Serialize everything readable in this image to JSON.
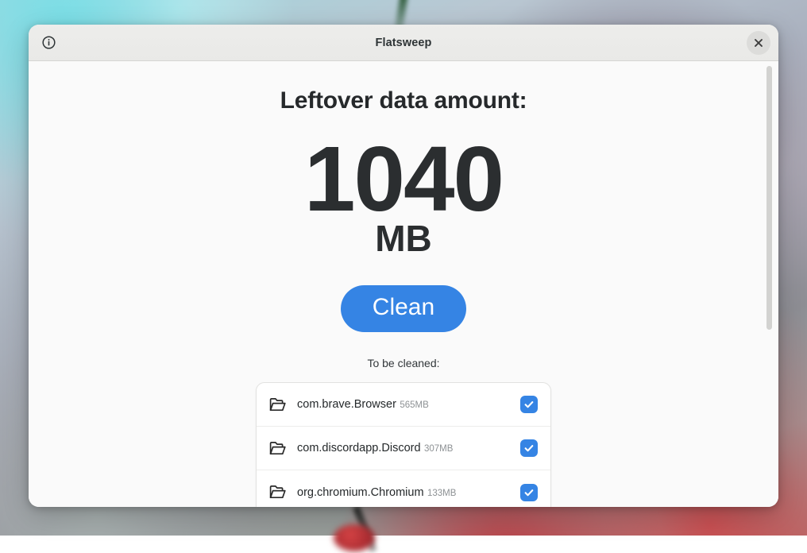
{
  "window": {
    "title": "Flatsweep",
    "about_icon": "info-circle-icon",
    "close_icon": "close-icon"
  },
  "main": {
    "heading": "Leftover data amount:",
    "amount_value": "1040",
    "amount_unit": "MB",
    "clean_button_label": "Clean",
    "to_be_cleaned_label": "To be cleaned:"
  },
  "colors": {
    "accent": "#3584e4",
    "headerbar": "#eaeae8",
    "content_bg": "#fafafa",
    "card_bg": "#ffffff",
    "text": "#24282a",
    "subtext": "#8d9194"
  },
  "clean_list": [
    {
      "name": "com.brave.Browser",
      "size": "565MB",
      "icon": "folder-open-icon",
      "checked": true
    },
    {
      "name": "com.discordapp.Discord",
      "size": "307MB",
      "icon": "folder-open-icon",
      "checked": true
    },
    {
      "name": "org.chromium.Chromium",
      "size": "133MB",
      "icon": "folder-open-icon",
      "checked": true
    }
  ]
}
